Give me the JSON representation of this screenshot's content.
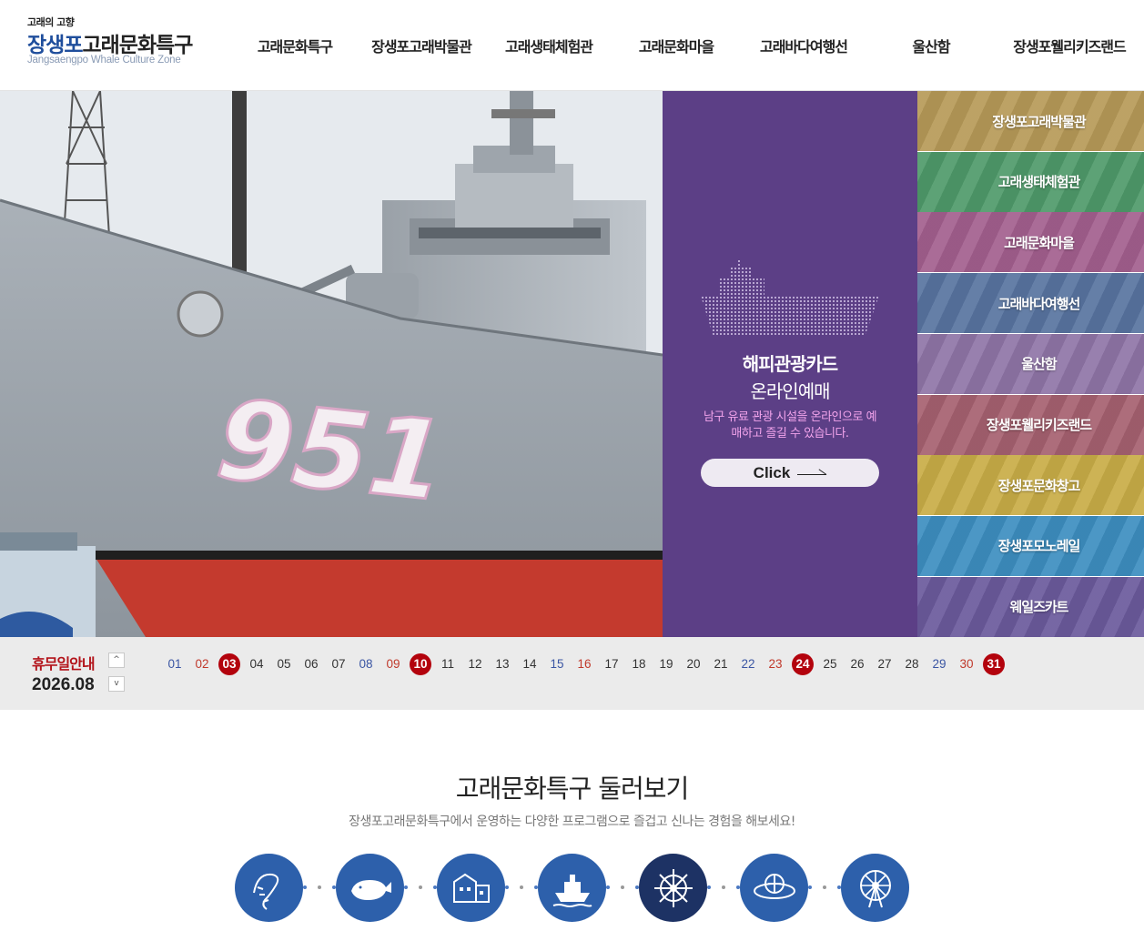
{
  "logo": {
    "small": "고래의 고향",
    "main_blue": "장생포",
    "main_dark": "고래문화특구",
    "english": "Jangsaengpo Whale Culture Zone"
  },
  "nav": [
    {
      "label": "고래문화특구",
      "w": 138
    },
    {
      "label": "장생포고래박물관",
      "w": 140
    },
    {
      "label": "고래생태체험관",
      "w": 140
    },
    {
      "label": "고래문화마을",
      "w": 140
    },
    {
      "label": "고래바다여행선",
      "w": 140
    },
    {
      "label": "울산함",
      "w": 140
    },
    {
      "label": "장생포웰리키즈랜드",
      "w": 164
    }
  ],
  "hero": {
    "ship_number": "951"
  },
  "card": {
    "title": "해피관광카드",
    "subtitle": "온라인예매",
    "description": "남구 유료 관광 시설을 온라인으로 예매하고 즐길 수 있습니다.",
    "button": "Click"
  },
  "quick_links": [
    {
      "label": "장생포고래박물관",
      "color": "#b79a58"
    },
    {
      "label": "고래생태체험관",
      "color": "#4f9a6a"
    },
    {
      "label": "고래문화마을",
      "color": "#a35f8e"
    },
    {
      "label": "고래바다여행선",
      "color": "#5874a0"
    },
    {
      "label": "울산함",
      "color": "#8f75a7"
    },
    {
      "label": "장생포웰리키즈랜드",
      "color": "#a66170"
    },
    {
      "label": "장생포문화창고",
      "color": "#c9ad47"
    },
    {
      "label": "장생포모노레일",
      "color": "#3d8ec0"
    },
    {
      "label": "웨일즈카트",
      "color": "#6b5a9c"
    }
  ],
  "holiday": {
    "label": "휴무일안내",
    "month": "2026.08",
    "up": "^",
    "down": "v",
    "days": [
      {
        "n": "01",
        "t": "sat"
      },
      {
        "n": "02",
        "t": "sun"
      },
      {
        "n": "03",
        "t": "off"
      },
      {
        "n": "04",
        "t": ""
      },
      {
        "n": "05",
        "t": ""
      },
      {
        "n": "06",
        "t": ""
      },
      {
        "n": "07",
        "t": ""
      },
      {
        "n": "08",
        "t": "sat"
      },
      {
        "n": "09",
        "t": "sun"
      },
      {
        "n": "10",
        "t": "off"
      },
      {
        "n": "11",
        "t": ""
      },
      {
        "n": "12",
        "t": ""
      },
      {
        "n": "13",
        "t": ""
      },
      {
        "n": "14",
        "t": ""
      },
      {
        "n": "15",
        "t": "sat"
      },
      {
        "n": "16",
        "t": "sun"
      },
      {
        "n": "17",
        "t": ""
      },
      {
        "n": "18",
        "t": ""
      },
      {
        "n": "19",
        "t": ""
      },
      {
        "n": "20",
        "t": ""
      },
      {
        "n": "21",
        "t": ""
      },
      {
        "n": "22",
        "t": "sat"
      },
      {
        "n": "23",
        "t": "sun"
      },
      {
        "n": "24",
        "t": "off"
      },
      {
        "n": "25",
        "t": ""
      },
      {
        "n": "26",
        "t": ""
      },
      {
        "n": "27",
        "t": ""
      },
      {
        "n": "28",
        "t": ""
      },
      {
        "n": "29",
        "t": "sat"
      },
      {
        "n": "30",
        "t": "sun"
      },
      {
        "n": "31",
        "t": "off"
      }
    ]
  },
  "overview": {
    "title": "고래문화특구 둘러보기",
    "description": "장생포고래문화특구에서 운영하는 다양한 프로그램으로 즐겁고 신나는 경험을 해보세요!",
    "icons": [
      {
        "name": "whale-skeleton-icon"
      },
      {
        "name": "whale-icon"
      },
      {
        "name": "village-icon"
      },
      {
        "name": "cruise-ship-icon"
      },
      {
        "name": "ship-wheel-icon"
      },
      {
        "name": "monorail-icon"
      },
      {
        "name": "ferris-wheel-icon"
      }
    ]
  }
}
